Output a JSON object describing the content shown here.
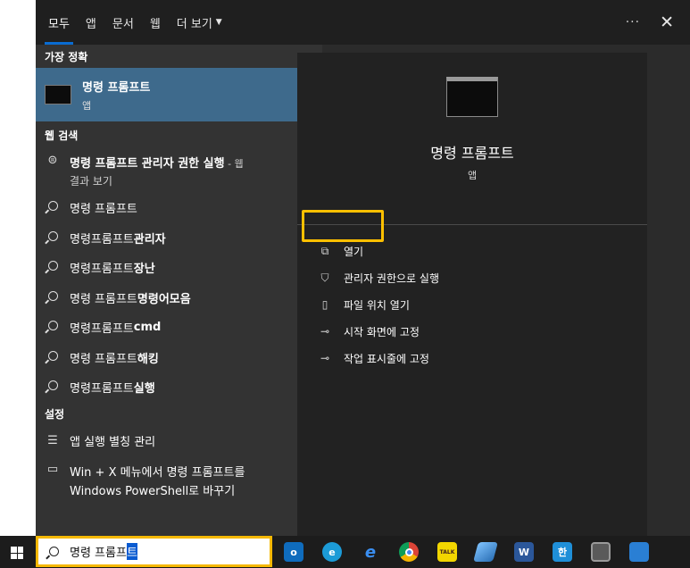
{
  "tabs": [
    {
      "label": "모두",
      "active": true
    },
    {
      "label": "앱"
    },
    {
      "label": "문서"
    },
    {
      "label": "웹"
    },
    {
      "label": "더 보기"
    }
  ],
  "top_actions": {
    "more": "···",
    "close": "✕"
  },
  "sections": {
    "best": "가장 정확",
    "web": "웹 검색",
    "settings": "설정"
  },
  "best_match": {
    "title": "명령 프롬프트",
    "subtitle": "앱"
  },
  "web_results": {
    "first": {
      "main": "명령 프롬프트 관리자 권한 실행",
      "suffix": " - 웹",
      "line2": "결과 보기"
    },
    "items": [
      {
        "normal": "명령 프롬프트",
        "bold": ""
      },
      {
        "normal": "명령프롬프트 ",
        "bold": "관리자"
      },
      {
        "normal": "명령프롬프트 ",
        "bold": "장난"
      },
      {
        "normal": "명령 프롬프트 ",
        "bold": "명령어모음"
      },
      {
        "normal": "명령프롬프트 ",
        "bold": "cmd"
      },
      {
        "normal": "명령 프롬프트 ",
        "bold": "해킹"
      },
      {
        "normal": "명령프롬프트 ",
        "bold": "실행"
      }
    ]
  },
  "settings_results": [
    {
      "line1": "앱 실행 별칭 관리",
      "line2": ""
    },
    {
      "line1": "Win + X 메뉴에서 명령 프롬프트를",
      "line2": "Windows PowerShell로 바꾸기"
    }
  ],
  "preview": {
    "title": "명령 프롬프트",
    "subtitle": "앱"
  },
  "actions": [
    {
      "label": "열기",
      "icon": "open-icon"
    },
    {
      "label": "관리자 권한으로 실행",
      "icon": "admin-shield-icon"
    },
    {
      "label": "파일 위치 열기",
      "icon": "file-location-icon"
    },
    {
      "label": "시작 화면에 고정",
      "icon": "pin-icon"
    },
    {
      "label": "작업 표시줄에 고정",
      "icon": "pin-icon"
    }
  ],
  "search": {
    "typed": "명령 프롬프",
    "selected": "트"
  },
  "taskbar_apps": [
    {
      "name": "outlook-icon",
      "glyph": "o",
      "color": "#0f6cbd"
    },
    {
      "name": "edge-icon",
      "glyph": "e",
      "color": "#1c9bd7"
    },
    {
      "name": "internet-explorer-icon",
      "glyph": "e",
      "color": "#1e7ae6"
    },
    {
      "name": "chrome-icon",
      "glyph": "",
      "color": "#db4437"
    },
    {
      "name": "kakaotalk-icon",
      "glyph": "TALK",
      "color": "#f2d600"
    },
    {
      "name": "note-app-icon",
      "glyph": "",
      "color": "#3f8fd1"
    },
    {
      "name": "word-icon",
      "glyph": "W",
      "color": "#2b579a"
    },
    {
      "name": "hangul-icon",
      "glyph": "한",
      "color": "#1f8fd8"
    },
    {
      "name": "calculator-icon",
      "glyph": "",
      "color": "#4b4b4b"
    },
    {
      "name": "media-app-icon",
      "glyph": "",
      "color": "#2a7fd4"
    }
  ]
}
